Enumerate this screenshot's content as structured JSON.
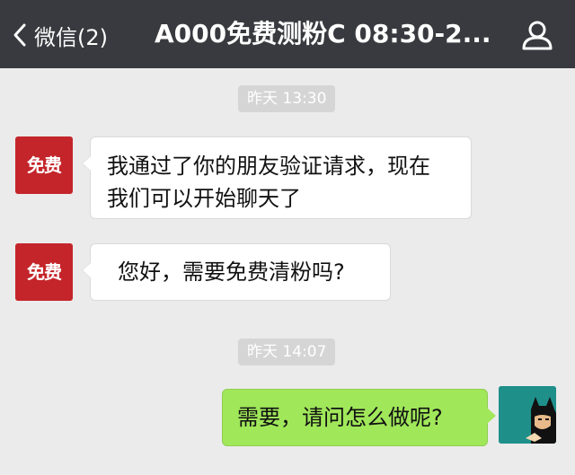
{
  "header": {
    "back_label": "微信(2)",
    "title": "A000免费测粉C 08:30-2...",
    "back_icon": "chevron-left-icon",
    "profile_icon": "user-icon"
  },
  "messages": [
    {
      "type": "timestamp",
      "text": "昨天 13:30"
    },
    {
      "type": "incoming",
      "avatar_text": "免费",
      "lines": [
        "我通过了你的朋友验证请求，现在",
        "我们可以开始聊天了"
      ]
    },
    {
      "type": "incoming",
      "avatar_text": "免费",
      "lines": [
        "您好，需要免费清粉吗?"
      ]
    },
    {
      "type": "timestamp",
      "text": "昨天 14:07"
    },
    {
      "type": "outgoing",
      "lines": [
        "需要，请问怎么做呢?"
      ]
    }
  ],
  "colors": {
    "topbar": "#393a3f",
    "chat_background": "#ebebeb",
    "outgoing_bubble": "#a0e75a",
    "incoming_bubble": "#ffffff",
    "avatar_red": "#c4252a"
  }
}
